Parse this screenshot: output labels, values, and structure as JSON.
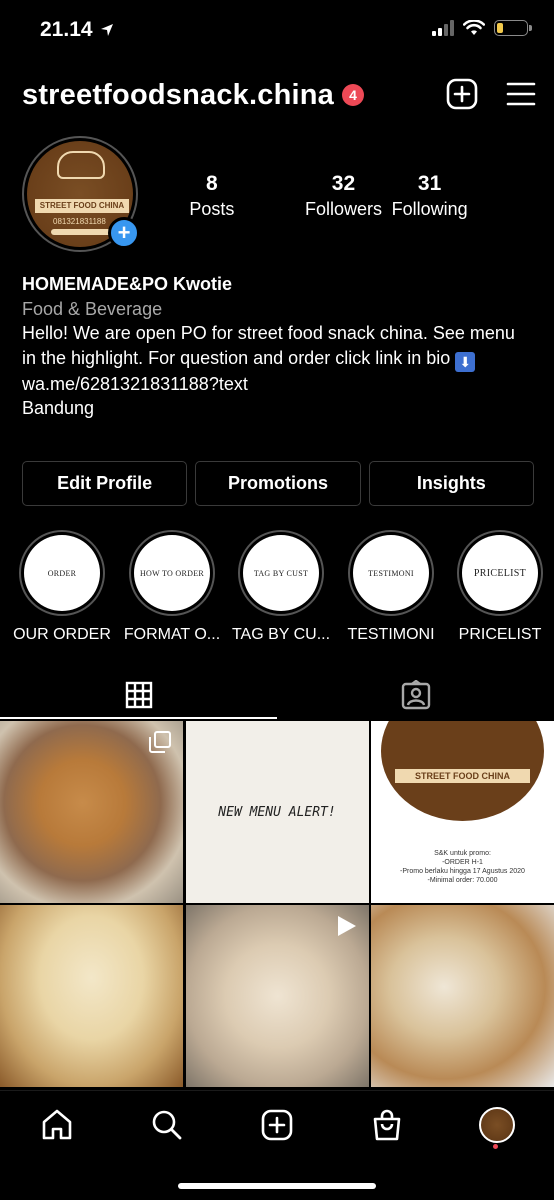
{
  "status_bar": {
    "time": "21.14",
    "battery_level": 0.2,
    "battery_color": "#f2c94c"
  },
  "header": {
    "username": "streetfoodsnack.china",
    "notification_count": "4",
    "badge_color": "#ed4956"
  },
  "profile": {
    "avatar_banner": "STREET FOOD CHINA",
    "avatar_phone": "081321831188",
    "stats": [
      {
        "value": "8",
        "label": "Posts"
      },
      {
        "value": "32",
        "label": "Followers"
      },
      {
        "value": "31",
        "label": "Following"
      }
    ]
  },
  "bio": {
    "name": "HOMEMADE&PO Kwotie",
    "category": "Food & Beverage",
    "text": "Hello! We are open PO for street food snack china. See menu in the highlight. For question and order click link in bio",
    "link": "wa.me/6281321831188?text",
    "location": "Bandung"
  },
  "buttons": {
    "edit_profile": "Edit Profile",
    "promotions": "Promotions",
    "insights": "Insights"
  },
  "highlights": [
    {
      "cover": "ORDER",
      "label": "OUR ORDER"
    },
    {
      "cover": "HOW TO ORDER",
      "label": "FORMAT O..."
    },
    {
      "cover": "TAG BY CUST",
      "label": "TAG BY CU..."
    },
    {
      "cover": "TESTIMONI",
      "label": "TESTIMONI"
    },
    {
      "cover": "PRICELIST",
      "label": "PRICELIST"
    }
  ],
  "tabs": {
    "active": "grid",
    "icons": [
      "grid-icon",
      "tagged-icon"
    ]
  },
  "posts": {
    "post2_text": "NEW MENU ALERT!",
    "post3_banner": "STREET FOOD CHINA",
    "post3_lines": [
      "S&K untuk promo:",
      "-ORDER H-1",
      "-Promo berlaku hingga 17 Agustus 2020",
      "-Minimal order: 70.000"
    ]
  },
  "accent_color": "#3897f0"
}
